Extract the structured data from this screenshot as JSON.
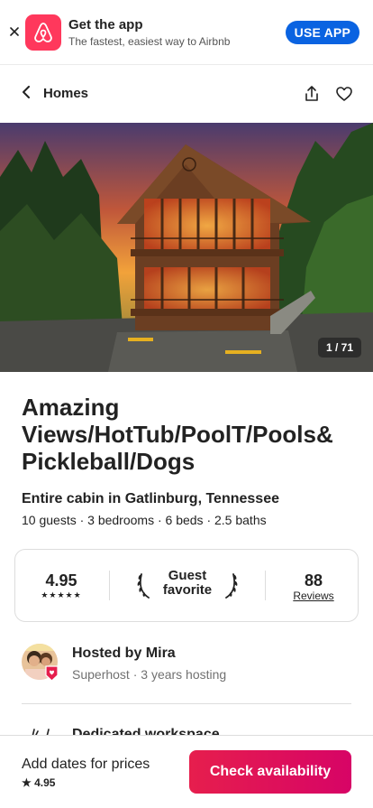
{
  "banner": {
    "title": "Get the app",
    "subtitle": "The fastest, easiest way to Airbnb",
    "cta": "USE APP"
  },
  "nav": {
    "back_label": "Homes"
  },
  "hero": {
    "photo_counter": "1 / 71"
  },
  "listing": {
    "title": "Amazing Views/HotTub/PoolT/Pools& Pickleball/Dogs",
    "type": "Entire cabin in Gatlinburg, Tennessee",
    "details": "10 guests · 3 bedrooms · 6 beds · 2.5 baths"
  },
  "stats": {
    "rating": "4.95",
    "stars": "★★★★★",
    "guest_favorite": "Guest favorite",
    "reviews_count": "88",
    "reviews_label": "Reviews"
  },
  "host": {
    "name": "Hosted by Mira",
    "meta": "Superhost · 3 years hosting"
  },
  "amenity_peek": {
    "label": "Dedicated workspace"
  },
  "footer": {
    "price_prompt": "Add dates for prices",
    "rating": "★ 4.95",
    "cta": "Check availability"
  },
  "colors": {
    "brand": "#ff385c",
    "app_button": "#0a63e1",
    "cta_start": "#e61e4d",
    "cta_end": "#d70466"
  }
}
